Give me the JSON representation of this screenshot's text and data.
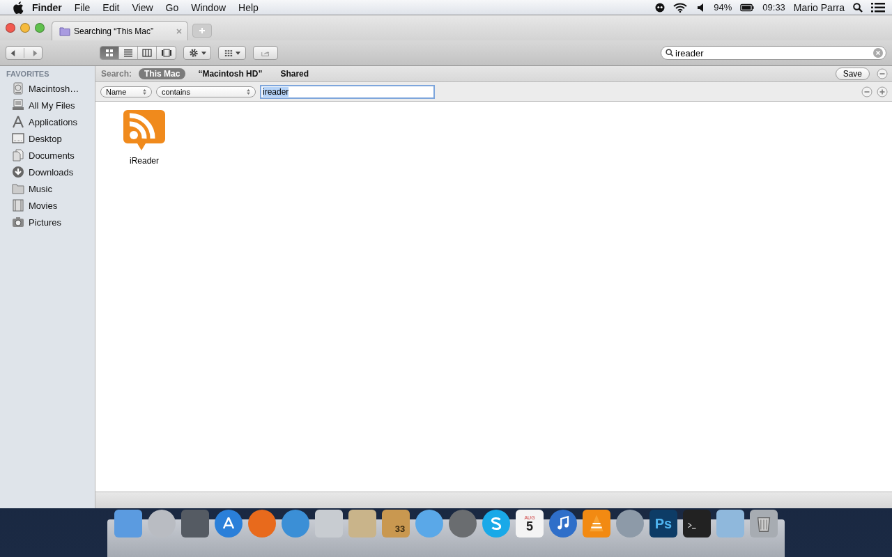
{
  "menubar": {
    "app": "Finder",
    "menus": [
      "File",
      "Edit",
      "View",
      "Go",
      "Window",
      "Help"
    ],
    "battery": "94%",
    "clock": "09:33",
    "user": "Mario Parra"
  },
  "window": {
    "tab": "Searching “This Mac”"
  },
  "toolbar": {
    "view_modes": [
      {
        "kind": "icons",
        "selected": true
      },
      {
        "kind": "list",
        "selected": false
      },
      {
        "kind": "columns",
        "selected": false
      },
      {
        "kind": "coverflow",
        "selected": false
      }
    ],
    "search": {
      "value": "ireader"
    }
  },
  "sidebar": {
    "heading": "FAVORITES",
    "items": [
      {
        "kind": "disk",
        "label": "Macintosh…",
        "selected": false
      },
      {
        "kind": "files",
        "label": "All My Files",
        "selected": false
      },
      {
        "kind": "apps",
        "label": "Applications",
        "selected": false
      },
      {
        "kind": "desktop",
        "label": "Desktop",
        "selected": false
      },
      {
        "kind": "docs",
        "label": "Documents",
        "selected": false
      },
      {
        "kind": "downloads",
        "label": "Downloads",
        "selected": false
      },
      {
        "kind": "folder",
        "label": "Music",
        "selected": false
      },
      {
        "kind": "movies",
        "label": "Movies",
        "selected": false
      },
      {
        "kind": "camera",
        "label": "Pictures",
        "selected": false
      }
    ]
  },
  "search_bar": {
    "label": "Search:",
    "scopes": [
      {
        "label": "This Mac",
        "selected": true
      },
      {
        "label": "“Macintosh HD”",
        "selected": false
      },
      {
        "label": "Shared",
        "selected": false
      }
    ],
    "save": "Save"
  },
  "criteria": {
    "attribute": "Name",
    "operator": "contains",
    "value": "ireader"
  },
  "results": [
    {
      "name": "iReader"
    }
  ],
  "dock": [
    {
      "kind": "finder"
    },
    {
      "kind": "rocket"
    },
    {
      "kind": "photos"
    },
    {
      "kind": "appstore"
    },
    {
      "kind": "firefox"
    },
    {
      "kind": "bird"
    },
    {
      "kind": "facetime"
    },
    {
      "kind": "mail"
    },
    {
      "kind": "package",
      "badge": "33"
    },
    {
      "kind": "messages"
    },
    {
      "kind": "robot"
    },
    {
      "kind": "skype"
    },
    {
      "kind": "calendar",
      "month": "AUG",
      "day": "5"
    },
    {
      "kind": "music"
    },
    {
      "kind": "cone"
    },
    {
      "kind": "keychain"
    },
    {
      "kind": "photoshop",
      "label": "Ps"
    },
    {
      "kind": "terminal"
    },
    {
      "kind": "folder"
    },
    {
      "kind": "trash"
    }
  ]
}
